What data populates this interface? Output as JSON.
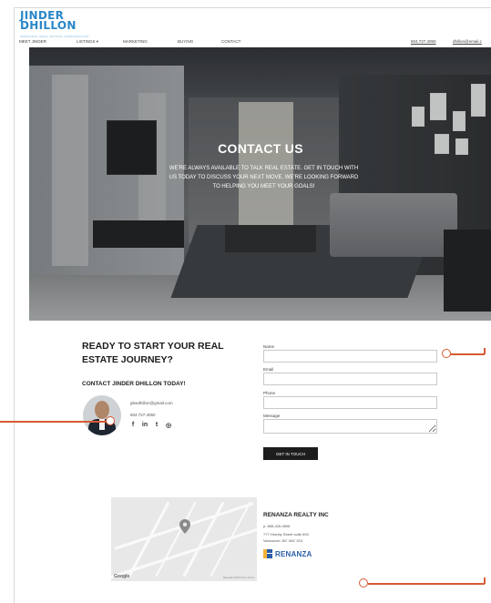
{
  "brand": {
    "line1": "JINDER",
    "line2": "DHILLON",
    "tagline": "PERSONAL REAL ESTATE CORPORATION"
  },
  "nav": {
    "items": [
      "Meet Jinder",
      "Listings ▾",
      "Marketing",
      "Buying",
      "Contact"
    ],
    "phone": "604.727.4050",
    "email": "dhillon@email.c"
  },
  "hero": {
    "title": "CONTACT US",
    "description": "We're always available to talk real estate. Get in touch with us today to discuss your next move. We're looking forward to helping you meet your goals!"
  },
  "contact": {
    "heading": "READY TO START YOUR REAL ESTATE JOURNEY?",
    "subheading": "CONTACT JINDER DHILLON TODAY!",
    "email": "jdeedhillon@gmail.com",
    "phone": "604.727.4050",
    "social_icons": [
      "facebook-icon",
      "linkedin-icon",
      "twitter-icon",
      "instagram-icon"
    ],
    "social_glyphs": [
      "f",
      "in",
      "t",
      "◎"
    ]
  },
  "form": {
    "name_label": "Name",
    "email_label": "Email",
    "phone_label": "Phone",
    "message_label": "Message",
    "submit_label": "GET IN TOUCH"
  },
  "map": {
    "provider": "Google",
    "terms": "Map data ©2020  Terms of Use"
  },
  "company": {
    "name": "RENANZA REALTY INC",
    "phone": "p: 888-426-0808",
    "address1": "777 Hornby Street suite 600",
    "address2": "Vancouver, BC  V6Z 1S4",
    "logo_text": "RENANZA"
  },
  "colors": {
    "brand_blue": "#2a86c8",
    "annotation": "#d65a34",
    "button": "#1d1d1d"
  }
}
